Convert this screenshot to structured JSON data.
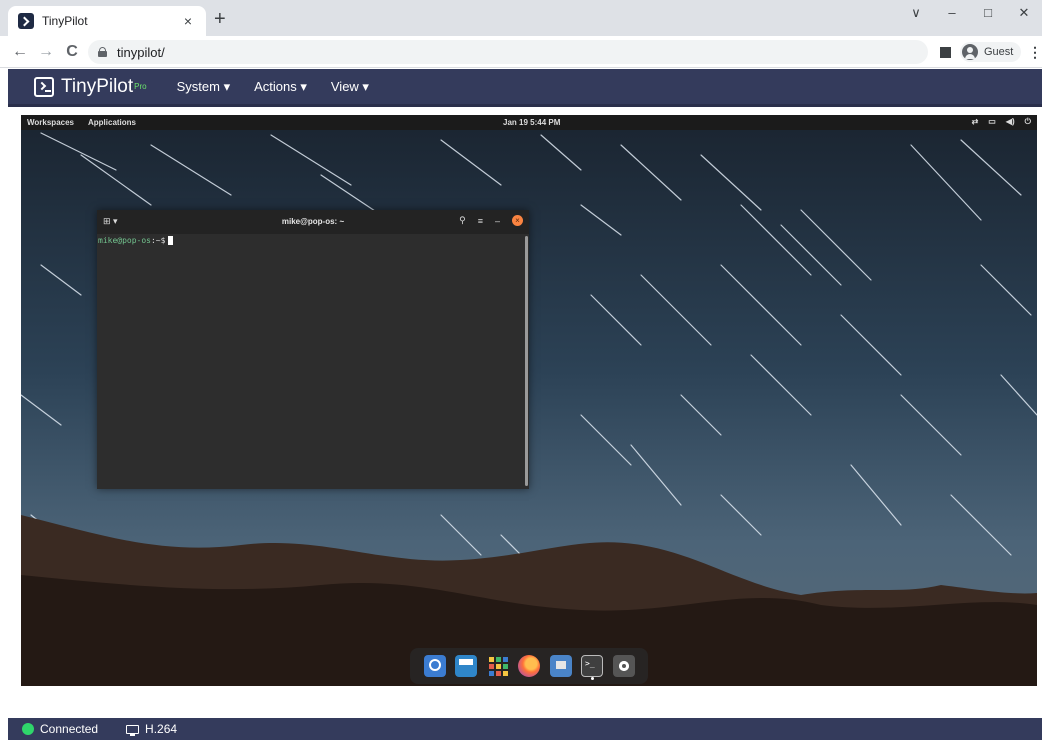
{
  "browser": {
    "tab_title": "TinyPilot",
    "tab_close": "×",
    "new_tab": "+",
    "controls": {
      "dropdown": "∨",
      "minimize": "–",
      "maximize": "□",
      "close": "✕"
    },
    "nav": {
      "back": "←",
      "forward": "→",
      "reload": "C"
    },
    "url": "tinypilot/",
    "profile_label": "Guest",
    "menu": "⋮"
  },
  "tinypilot": {
    "logo_text": "TinyPilot",
    "logo_badge": "Pro",
    "menus": [
      {
        "label": "System ▾"
      },
      {
        "label": "Actions ▾"
      },
      {
        "label": "View ▾"
      }
    ]
  },
  "remote": {
    "top_bar": {
      "workspaces": "Workspaces",
      "applications": "Applications",
      "clock": "Jan 19  5:44 PM"
    },
    "terminal": {
      "newtab_icon": "⊞ ▾",
      "title": "mike@pop-os: ~",
      "search_icon": "⚲",
      "menu_icon": "≡",
      "minimize_icon": "–",
      "close_icon": "×",
      "prompt_user": "mike@pop-os",
      "prompt_sign": ":~$"
    },
    "dock_icons": [
      "search-icon",
      "tiles-icon",
      "app-grid-icon",
      "firefox-icon",
      "files-icon",
      "terminal-icon",
      "settings-icon"
    ]
  },
  "status": {
    "connection": "Connected",
    "codec": "H.264",
    "connected_color": "#2fd66b"
  }
}
